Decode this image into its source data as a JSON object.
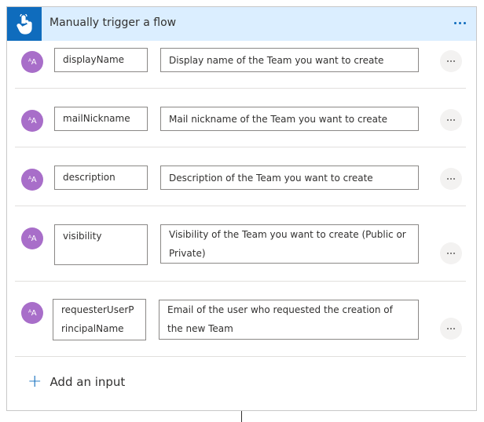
{
  "header": {
    "title": "Manually trigger a flow",
    "icon": "touch-hand-icon",
    "more": "ellipsis-icon",
    "accent": "#0f6cbd",
    "background": "#dbeeff"
  },
  "inputs": [
    {
      "name": "displayName",
      "description": "Display name of the Team you want to create",
      "avatar": "AA"
    },
    {
      "name": "mailNickname",
      "description": "Mail nickname of the Team you want to create",
      "avatar": "AA"
    },
    {
      "name": "description",
      "description": "Description of the Team you want to create",
      "avatar": "AA"
    },
    {
      "name": "visibility",
      "description": "Visibility of the Team you want to create (Public or Private)",
      "avatar": "AA"
    },
    {
      "name": "requesterUserPrincipalName",
      "description": "Email of the user who requested the creation of the new Team",
      "avatar": "AA"
    }
  ],
  "add_input": {
    "label": "Add an input"
  }
}
